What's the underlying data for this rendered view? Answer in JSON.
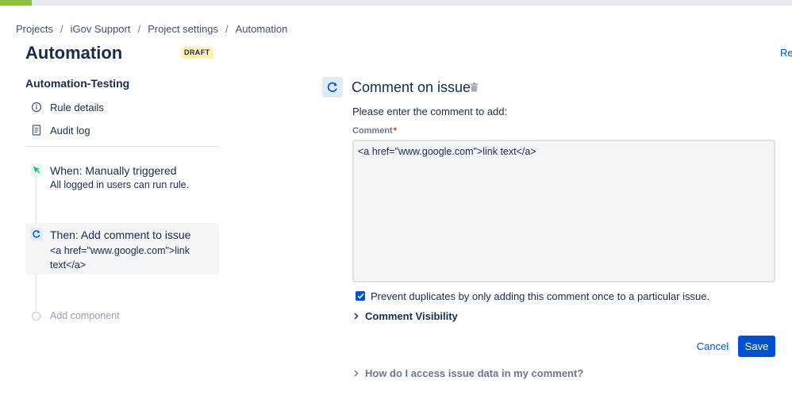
{
  "breadcrumb": [
    "Projects",
    "iGov Support",
    "Project settings",
    "Automation"
  ],
  "breadcrumb_separator": "/",
  "page": {
    "title": "Automation",
    "status_badge": "DRAFT",
    "top_right_link": "Re"
  },
  "sidebar": {
    "rule_name": "Automation-Testing",
    "links": [
      {
        "label": "Rule details",
        "icon": "info-icon"
      },
      {
        "label": "Audit log",
        "icon": "document-icon"
      }
    ]
  },
  "rule_steps": [
    {
      "title": "When: Manually triggered",
      "description": "All logged in users can run rule.",
      "icon": "cursor-trigger-icon",
      "icon_color": "#36b37e"
    },
    {
      "title": "Then: Add comment to issue",
      "description": "<a href=\"www.google.com\">link text</a>",
      "icon": "comment-refresh-icon",
      "icon_color": "#0052cc"
    }
  ],
  "add_component_label": "Add component",
  "panel": {
    "title": "Comment on issue",
    "instruction": "Please enter the comment to add:",
    "comment_label": "Comment",
    "required_marker": "*",
    "comment_value": "<a href=\"www.google.com\">link text</a>",
    "prevent_duplicates": {
      "checked": true,
      "label": "Prevent duplicates by only adding this comment once to a particular issue."
    },
    "visibility_label": "Comment Visibility",
    "cancel_label": "Cancel",
    "save_label": "Save",
    "help_label": "How do I access issue data in my comment?"
  },
  "colors": {
    "accent": "#0052cc",
    "draft_badge_bg": "#fff0b3",
    "required": "#de350b",
    "progress": "#8fbf40"
  }
}
